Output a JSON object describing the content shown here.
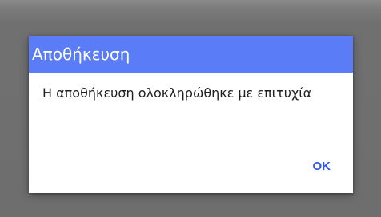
{
  "dialog": {
    "title": "Αποθήκευση",
    "message": "Η αποθήκευση ολοκληρώθηκε με επιτυχία",
    "ok_label": "OK"
  },
  "colors": {
    "title_bar": "#5b7cf7",
    "button_text": "#2c57e8",
    "scrim": "#707070"
  }
}
